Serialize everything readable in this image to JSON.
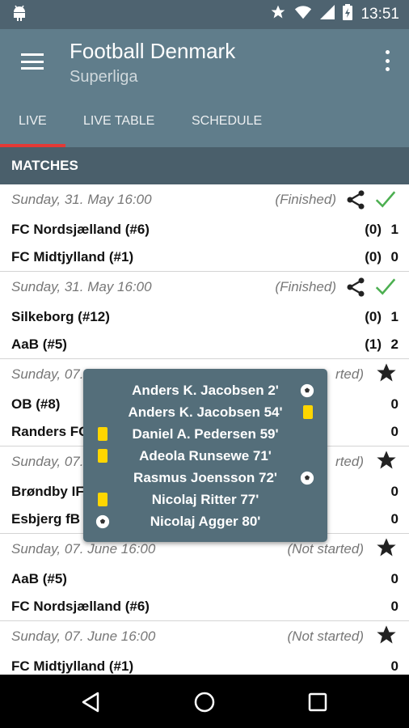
{
  "status_bar": {
    "time": "13:51"
  },
  "app_bar": {
    "title": "Football Denmark",
    "subtitle": "Superliga"
  },
  "tabs": [
    {
      "label": "LIVE"
    },
    {
      "label": "LIVE TABLE"
    },
    {
      "label": "SCHEDULE"
    }
  ],
  "section": {
    "title": "MATCHES"
  },
  "matches": [
    {
      "date": "Sunday, 31. May 16:00",
      "status": "(Finished)",
      "home": {
        "name": "FC Nordsjælland (#6)",
        "half": "(0)",
        "score": "1"
      },
      "away": {
        "name": "FC Midtjylland (#1)",
        "half": "(0)",
        "score": "0"
      }
    },
    {
      "date": "Sunday, 31. May 16:00",
      "status": "(Finished)",
      "home": {
        "name": "Silkeborg (#12)",
        "half": "(0)",
        "score": "1"
      },
      "away": {
        "name": "AaB (#5)",
        "half": "(1)",
        "score": "2"
      }
    },
    {
      "date": "Sunday, 07.",
      "status": "rted)",
      "home": {
        "name": "OB (#8)",
        "half": "",
        "score": "0"
      },
      "away": {
        "name": "Randers FC",
        "half": "",
        "score": "0"
      }
    },
    {
      "date": "Sunday, 07.",
      "status": "rted)",
      "home": {
        "name": "Brøndby IF",
        "half": "",
        "score": "0"
      },
      "away": {
        "name": "Esbjerg fB",
        "half": "",
        "score": "0"
      }
    },
    {
      "date": "Sunday, 07. June 16:00",
      "status": "(Not started)",
      "home": {
        "name": "AaB (#5)",
        "half": "",
        "score": "0"
      },
      "away": {
        "name": "FC Nordsjælland (#6)",
        "half": "",
        "score": "0"
      }
    },
    {
      "date": "Sunday, 07. June 16:00",
      "status": "(Not started)",
      "home": {
        "name": "FC Midtjylland (#1)",
        "half": "",
        "score": "0"
      },
      "away": {
        "name": "",
        "half": "",
        "score": ""
      }
    }
  ],
  "popup_events": [
    {
      "text": "Anders K. Jacobsen   2'",
      "icon": "ball-icon",
      "side": "right"
    },
    {
      "text": "Anders K. Jacobsen   54'",
      "icon": "yellow-card-icon",
      "side": "right"
    },
    {
      "text": "Daniel A. Pedersen   59'",
      "icon": "yellow-card-icon",
      "side": "left"
    },
    {
      "text": "Adeola Runsewe   71'",
      "icon": "yellow-card-icon",
      "side": "left"
    },
    {
      "text": "Rasmus Joensson   72'",
      "icon": "ball-icon",
      "side": "right"
    },
    {
      "text": "Nicolaj Ritter   77'",
      "icon": "yellow-card-icon",
      "side": "left"
    },
    {
      "text": "Nicolaj Agger   80'",
      "icon": "ball-icon",
      "side": "left"
    }
  ],
  "colors": {
    "app_bar": "#607d8b",
    "status_bar": "#4e6370",
    "section_header": "#4a5f6b",
    "tab_indicator": "#e53935",
    "check": "#4caf50",
    "yellow_card": "#ffd600",
    "popup": "#546e7a"
  }
}
